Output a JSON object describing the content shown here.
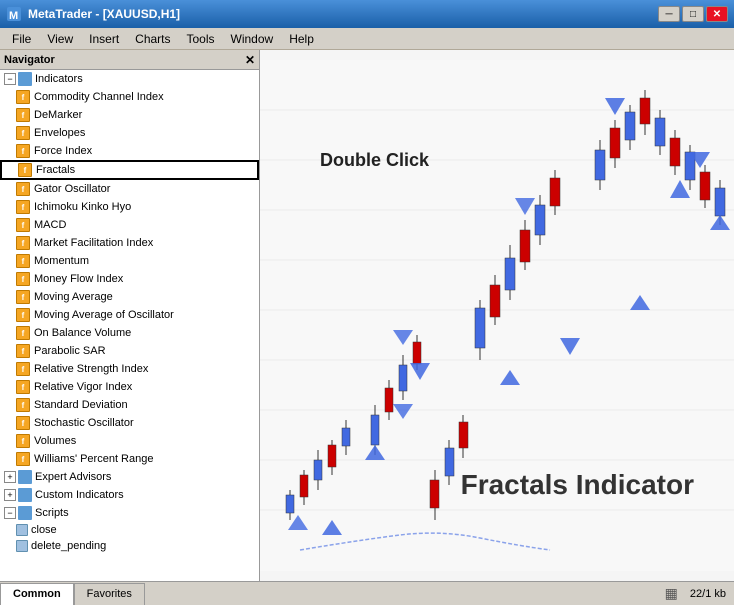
{
  "titlebar": {
    "title": "MetaTrader - [XAUUSD,H1]",
    "minimize": "─",
    "maximize": "□",
    "close": "✕"
  },
  "menubar": {
    "items": [
      "File",
      "View",
      "Insert",
      "Charts",
      "Tools",
      "Window",
      "Help"
    ]
  },
  "navigator": {
    "title": "Navigator",
    "indicators": [
      "Commodity Channel Index",
      "DeMarker",
      "Envelopes",
      "Force Index",
      "Fractals",
      "Gator Oscillator",
      "Ichimoku Kinko Hyo",
      "MACD",
      "Market Facilitation Index",
      "Momentum",
      "Money Flow Index",
      "Moving Average",
      "Moving Average of Oscillator",
      "On Balance Volume",
      "Parabolic SAR",
      "Relative Strength Index",
      "Relative Vigor Index",
      "Standard Deviation",
      "Stochastic Oscillator",
      "Volumes",
      "Williams' Percent Range"
    ],
    "sections": [
      {
        "label": "Expert Advisors",
        "expanded": false
      },
      {
        "label": "Custom Indicators",
        "expanded": false
      },
      {
        "label": "Scripts",
        "expanded": true
      }
    ],
    "scripts": [
      "close",
      "delete_pending"
    ]
  },
  "tabs": {
    "items": [
      "Common",
      "Favorites"
    ]
  },
  "status": {
    "size": "22/1 kb"
  },
  "chart": {
    "double_click_label": "Double Click",
    "fractals_label": "Fractals Indicator"
  }
}
